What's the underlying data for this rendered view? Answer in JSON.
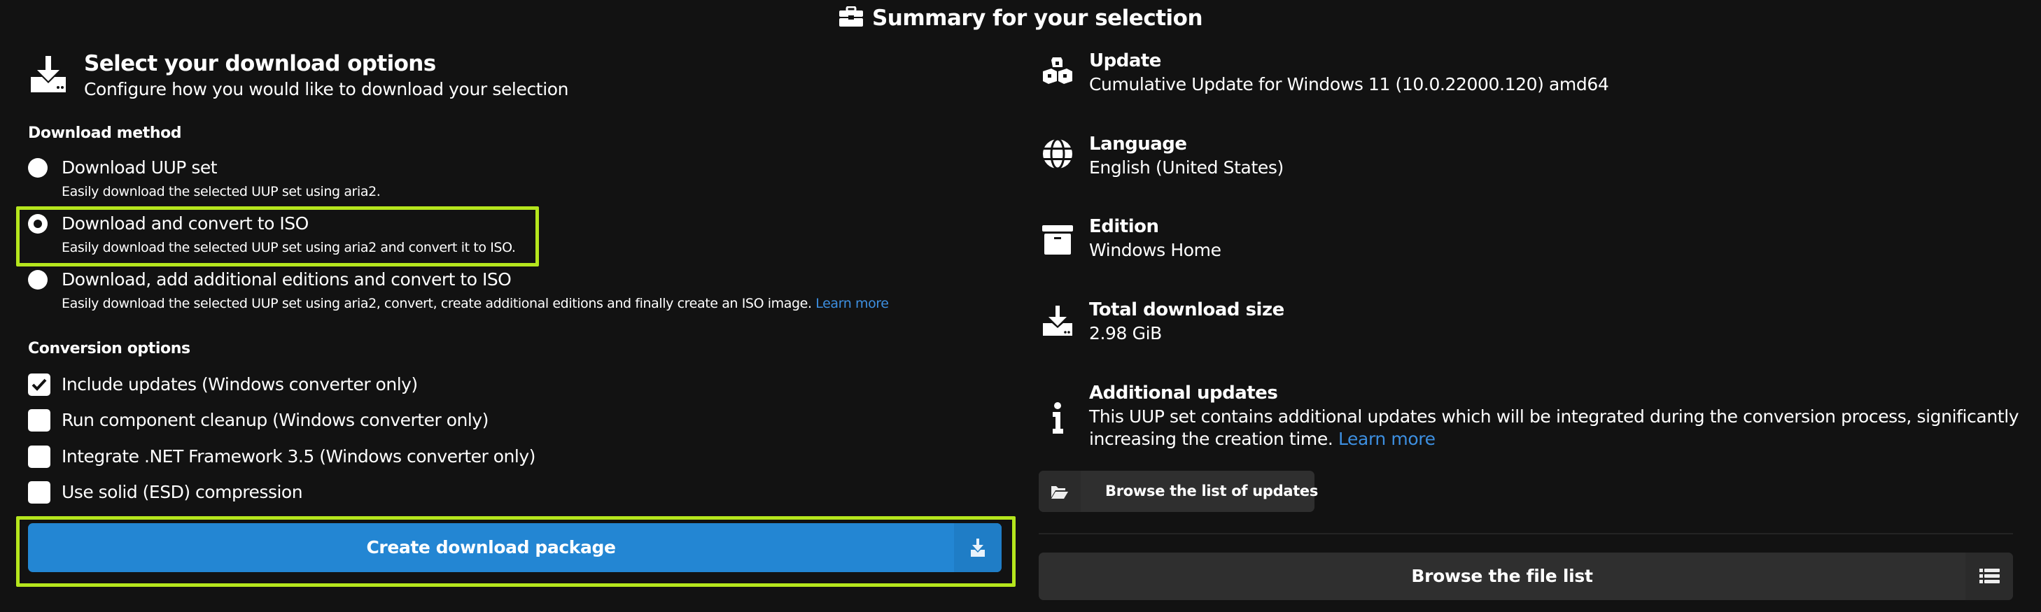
{
  "summary": {
    "title": "Summary for your selection",
    "icon": "toolbox-icon"
  },
  "download_options": {
    "icon": "download-icon",
    "title": "Select your download options",
    "subtitle": "Configure how you would like to download your selection",
    "method_label": "Download method",
    "methods": [
      {
        "label": "Download UUP set",
        "description": "Easily download the selected UUP set using aria2.",
        "selected": false
      },
      {
        "label": "Download and convert to ISO",
        "description": "Easily download the selected UUP set using aria2 and convert it to ISO.",
        "selected": true
      },
      {
        "label": "Download, add additional editions and convert to ISO",
        "description": "Easily download the selected UUP set using aria2, convert, create additional editions and finally create an ISO image.",
        "link": "Learn more",
        "selected": false
      }
    ],
    "conversion_label": "Conversion options",
    "conversion_options": [
      {
        "label": "Include updates (Windows converter only)",
        "checked": true
      },
      {
        "label": "Run component cleanup (Windows converter only)",
        "checked": false
      },
      {
        "label": "Integrate .NET Framework 3.5 (Windows converter only)",
        "checked": false
      },
      {
        "label": "Use solid (ESD) compression",
        "checked": false
      }
    ],
    "create_button": "Create download package"
  },
  "details": [
    {
      "key": "Update",
      "value": "Cumulative Update for Windows 11 (10.0.22000.120) amd64",
      "icon": "cubes-icon"
    },
    {
      "key": "Language",
      "value": "English (United States)",
      "icon": "globe-icon"
    },
    {
      "key": "Edition",
      "value": "Windows Home",
      "icon": "archive-box-icon"
    },
    {
      "key": "Total download size",
      "value": "2.98 GiB",
      "icon": "download-icon"
    },
    {
      "key": "Additional updates",
      "value": "This UUP set contains additional updates which will be integrated during the conversion process, significantly",
      "value_line2": "increasing the creation time.",
      "link": "Learn more",
      "icon": "info-icon"
    }
  ],
  "browse_updates_button": "Browse the list of updates",
  "browse_files_button": "Browse the file list",
  "colors": {
    "background": "#121212",
    "primary": "#2386d3",
    "link": "#3d8fe0",
    "highlight": "#b5e61d",
    "secondary_button": "#2f2f2f"
  }
}
